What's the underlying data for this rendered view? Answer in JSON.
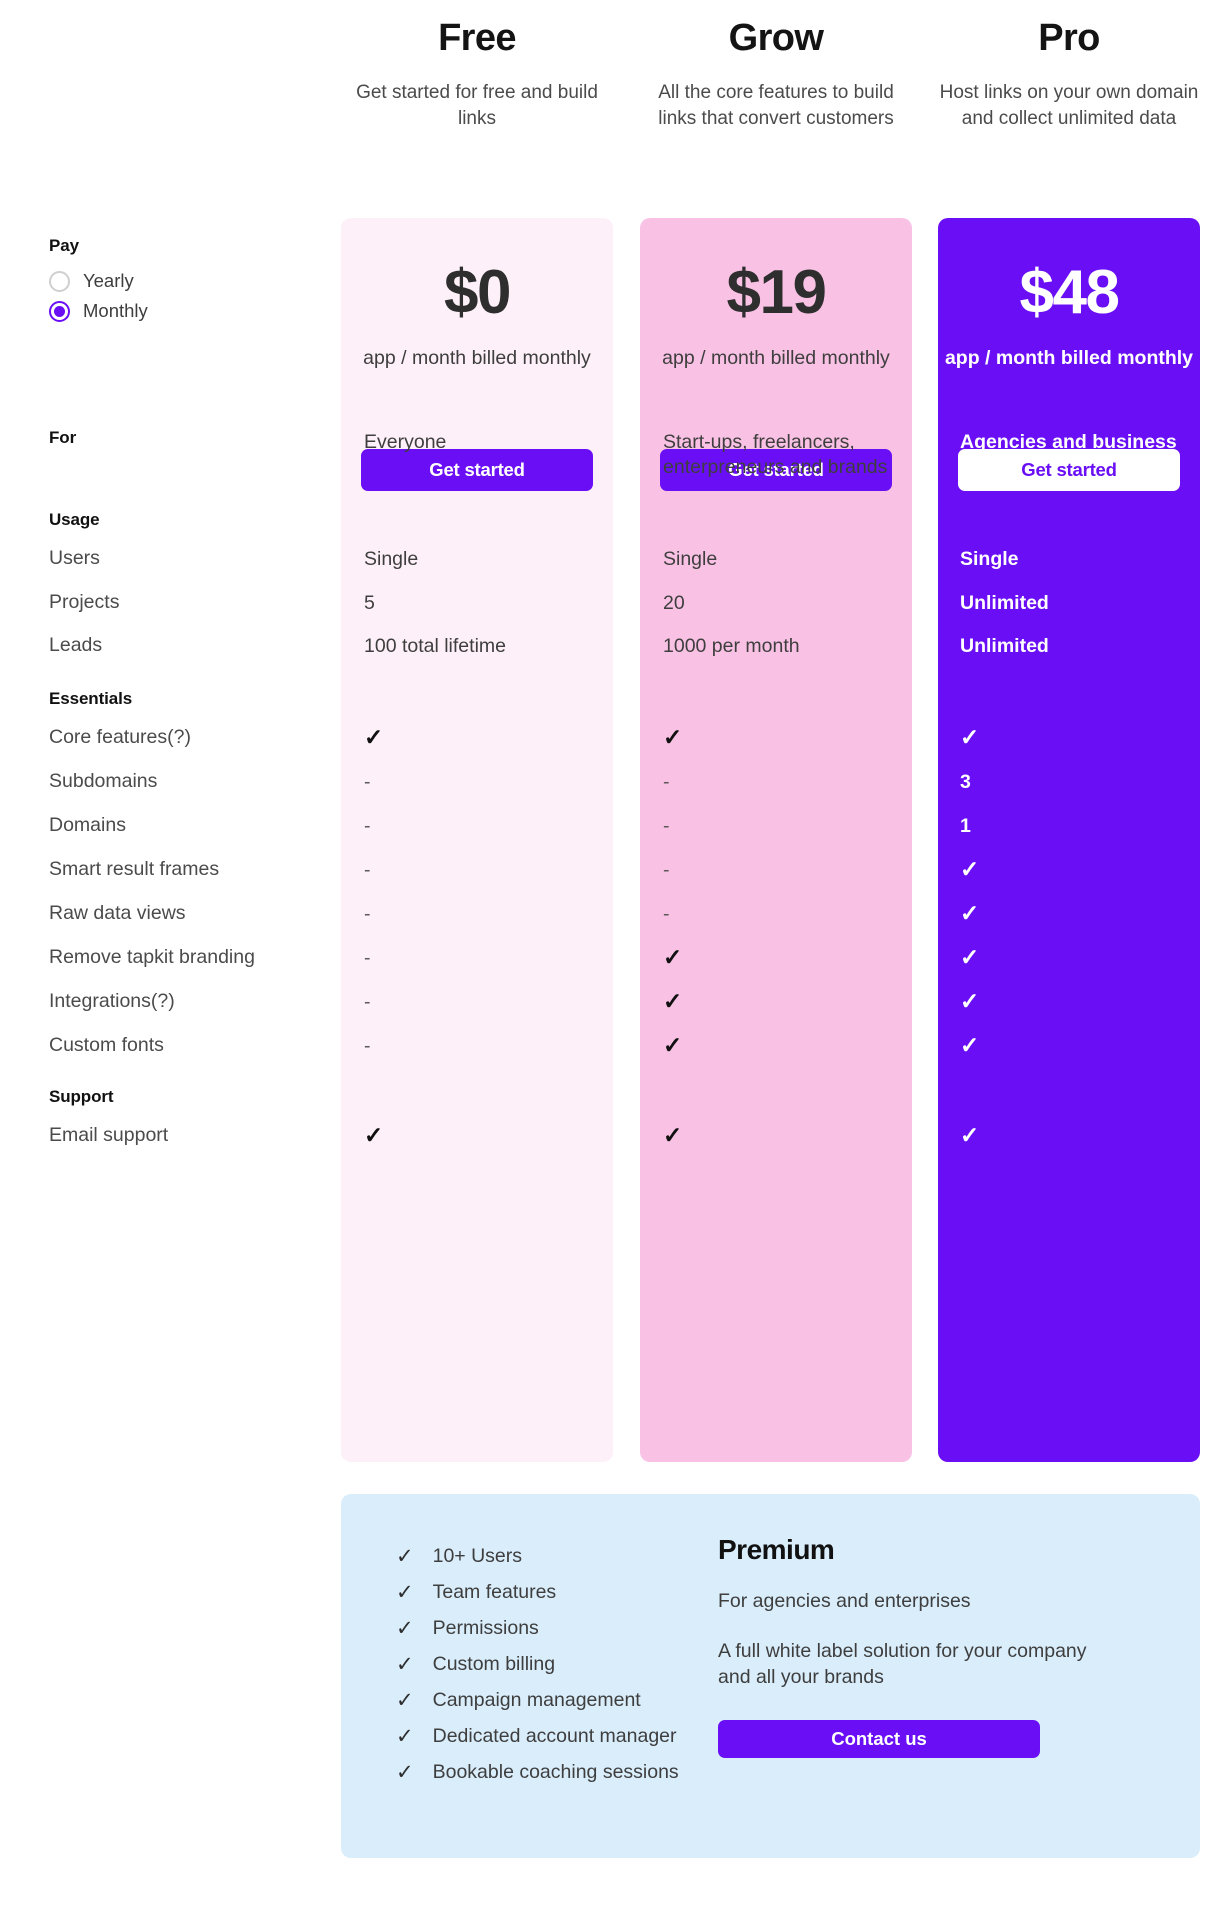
{
  "pay": {
    "title": "Pay",
    "options": [
      {
        "label": "Yearly",
        "selected": false
      },
      {
        "label": "Monthly",
        "selected": true
      }
    ]
  },
  "plans": [
    {
      "key": "free",
      "name": "Free",
      "description": "Get started for free and build links",
      "price": "$0",
      "price_sub": "app / month\nbilled monthly",
      "cta": "Get started",
      "card_color": "#fdf0f8",
      "cta_style": "solid"
    },
    {
      "key": "grow",
      "name": "Grow",
      "description": "All the core features to build links that convert customers",
      "price": "$19",
      "price_sub": "app / month\nbilled monthly",
      "cta": "Get started",
      "card_color": "#f9c2e4",
      "cta_style": "solid"
    },
    {
      "key": "pro",
      "name": "Pro",
      "description": "Host links on your own domain and collect unlimited data",
      "price": "$48",
      "price_sub": "app / month\nbilled monthly",
      "cta": "Get started",
      "card_color": "#6a0ff5",
      "cta_style": "ghost"
    }
  ],
  "groups": [
    {
      "title": "For",
      "rows": [
        {
          "label": "",
          "free": "Everyone",
          "grow": "Start-ups, freelancers, enterpreneurs and brands",
          "pro": "Agencies and business"
        }
      ]
    },
    {
      "title": "Usage",
      "rows": [
        {
          "label": "Users",
          "free": "Single",
          "grow": "Single",
          "pro": "Single"
        },
        {
          "label": "Projects",
          "free": "5",
          "grow": "20",
          "pro": "Unlimited"
        },
        {
          "label": "Leads",
          "free": "100 total lifetime",
          "grow": "1000 per month",
          "pro": "Unlimited"
        }
      ]
    },
    {
      "title": "Essentials",
      "rows": [
        {
          "label": "Core features(?)",
          "free": "check",
          "grow": "check",
          "pro": "check"
        },
        {
          "label": "Subdomains",
          "free": "-",
          "grow": "-",
          "pro": "3"
        },
        {
          "label": "Domains",
          "free": "-",
          "grow": "-",
          "pro": "1"
        },
        {
          "label": "Smart result frames",
          "free": "-",
          "grow": "-",
          "pro": "check"
        },
        {
          "label": "Raw data views",
          "free": "-",
          "grow": "-",
          "pro": "check"
        },
        {
          "label": "Remove tapkit branding",
          "free": "-",
          "grow": "check",
          "pro": "check"
        },
        {
          "label": "Integrations(?)",
          "free": "-",
          "grow": "check",
          "pro": "check"
        },
        {
          "label": "Custom fonts",
          "free": "-",
          "grow": "check",
          "pro": "check"
        }
      ]
    },
    {
      "title": "Support",
      "rows": [
        {
          "label": "Email support",
          "free": "check",
          "grow": "check",
          "pro": "check"
        }
      ]
    }
  ],
  "premium": {
    "features": [
      "10+ Users",
      "Team features",
      "Permissions",
      "Custom billing",
      "Campaign management",
      "Dedicated account manager",
      "Bookable coaching sessions"
    ],
    "title": "Premium",
    "subtitle": "For agencies and enterprises",
    "body": "A full white label solution for your company and all your brands",
    "cta": "Contact us",
    "panel_color": "#d9edfb"
  },
  "accent": "#6a0ff5",
  "glyphs": {
    "check": "✓",
    "dash": "-"
  }
}
